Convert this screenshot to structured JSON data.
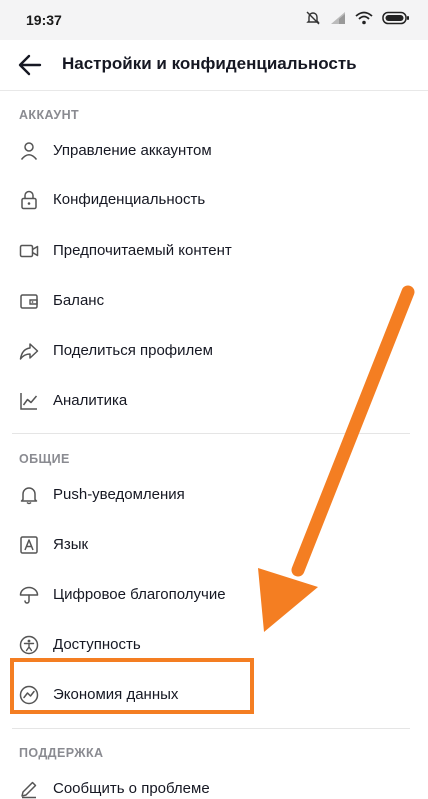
{
  "status_bar": {
    "time": "19:37"
  },
  "header": {
    "title": "Настройки и конфиденциальность"
  },
  "sections": {
    "account": {
      "title": "АККАУНТ",
      "items": [
        {
          "label": "Управление аккаунтом",
          "icon": "person-icon"
        },
        {
          "label": "Конфиденциальность",
          "icon": "lock-icon"
        },
        {
          "label": "Предпочитаемый контент",
          "icon": "video-camera-icon"
        },
        {
          "label": "Баланс",
          "icon": "wallet-icon"
        },
        {
          "label": "Поделиться профилем",
          "icon": "share-icon"
        },
        {
          "label": "Аналитика",
          "icon": "analytics-chart-icon"
        }
      ]
    },
    "general": {
      "title": "ОБЩИЕ",
      "items": [
        {
          "label": "Push-уведомления",
          "icon": "bell-icon"
        },
        {
          "label": "Язык",
          "icon": "language-icon"
        },
        {
          "label": "Цифровое благополучие",
          "icon": "umbrella-icon"
        },
        {
          "label": "Доступность",
          "icon": "accessibility-icon"
        },
        {
          "label": "Экономия данных",
          "icon": "data-saver-icon"
        }
      ]
    },
    "support": {
      "title": "ПОДДЕРЖКА",
      "items": [
        {
          "label": "Сообщить о проблеме",
          "icon": "pencil-icon"
        }
      ]
    }
  },
  "colors": {
    "annotation": "#f47e22",
    "text": "#161823",
    "muted": "#8a8b91"
  }
}
